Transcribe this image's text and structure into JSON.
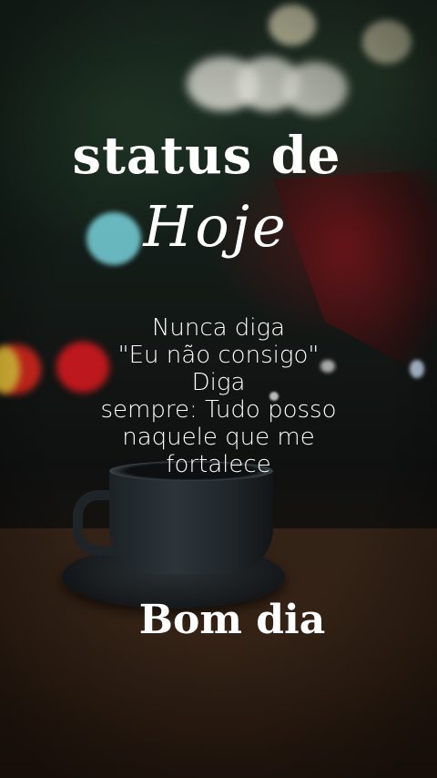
{
  "title": {
    "line1": "status de",
    "line2": "Hoje"
  },
  "quote": {
    "lines": [
      "Nunca diga",
      "\"Eu não consigo\"",
      "Diga",
      "sempre: Tudo posso",
      "naquele que me",
      "fortalece"
    ]
  },
  "greeting": "Bom dia",
  "colors": {
    "text": "#ffffff",
    "bokeh_red": "#e6281e",
    "bokeh_cyan": "#78d2dc"
  }
}
